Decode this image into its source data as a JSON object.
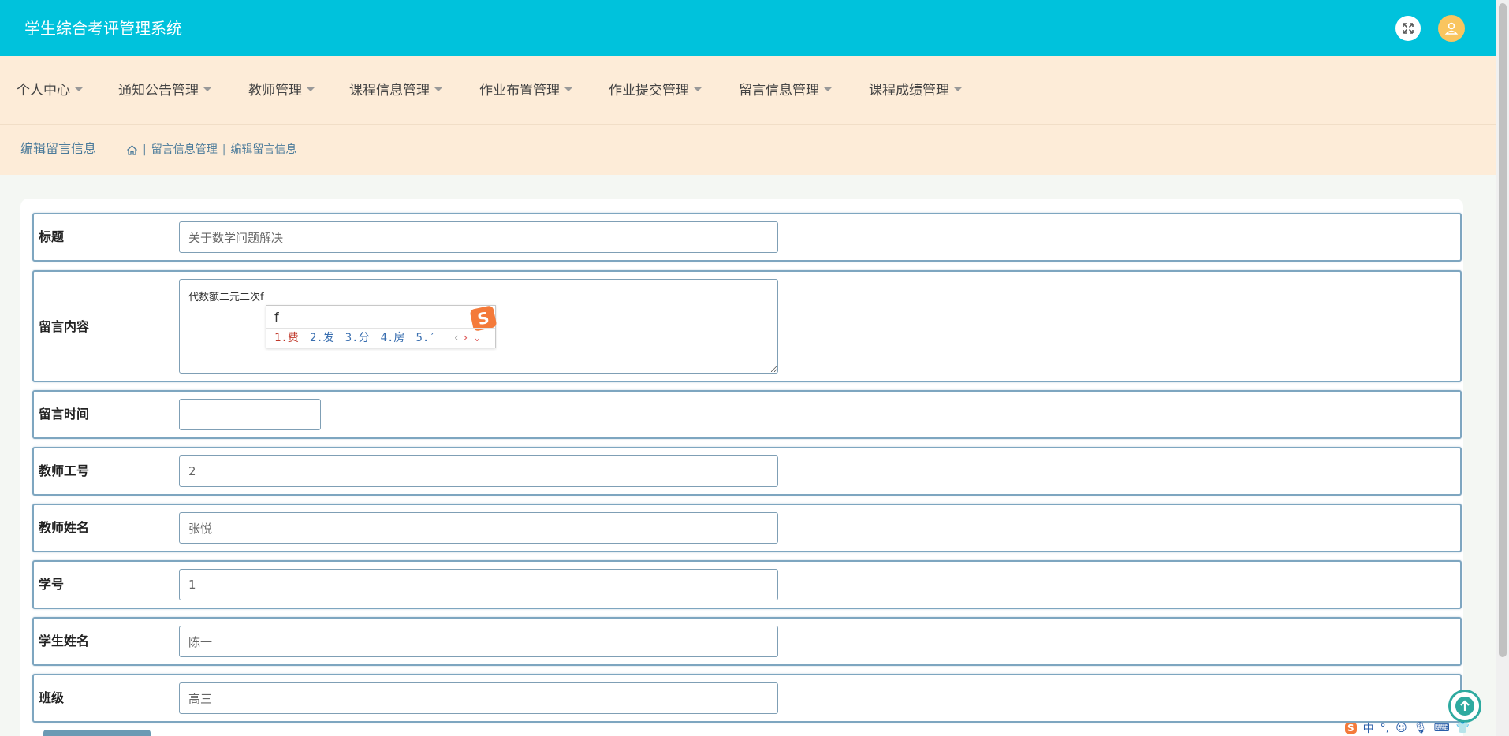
{
  "header": {
    "title": "学生综合考评管理系统"
  },
  "nav": {
    "items": [
      {
        "label": "个人中心"
      },
      {
        "label": "通知公告管理"
      },
      {
        "label": "教师管理"
      },
      {
        "label": "课程信息管理"
      },
      {
        "label": "作业布置管理"
      },
      {
        "label": "作业提交管理"
      },
      {
        "label": "留言信息管理"
      },
      {
        "label": "课程成绩管理"
      }
    ]
  },
  "breadcrumb": {
    "page_title": "编辑留言信息",
    "section": "留言信息管理",
    "current": "编辑留言信息"
  },
  "form": {
    "title_label": "标题",
    "title_value": "关于数学问题解决",
    "content_label": "留言内容",
    "content_value": "代数额二元二次f",
    "time_label": "留言时间",
    "time_value": "",
    "teacher_id_label": "教师工号",
    "teacher_id_value": "2",
    "teacher_name_label": "教师姓名",
    "teacher_name_value": "张悦",
    "student_id_label": "学号",
    "student_id_value": "1",
    "student_name_label": "学生姓名",
    "student_name_value": "陈一",
    "class_label": "班级",
    "class_value": "高三"
  },
  "ime": {
    "input": "f",
    "candidates": [
      "1.费",
      "2.发",
      "3.分",
      "4.房",
      "5.′"
    ]
  },
  "tray": {
    "lang": "中",
    "punct": "°,"
  },
  "colors": {
    "header_bg": "#00c2dc",
    "nav_bg": "#fdecd8",
    "row_border": "#7ea6c0",
    "avatar": "#f9c55f",
    "back_top": "#2eaaa0"
  }
}
